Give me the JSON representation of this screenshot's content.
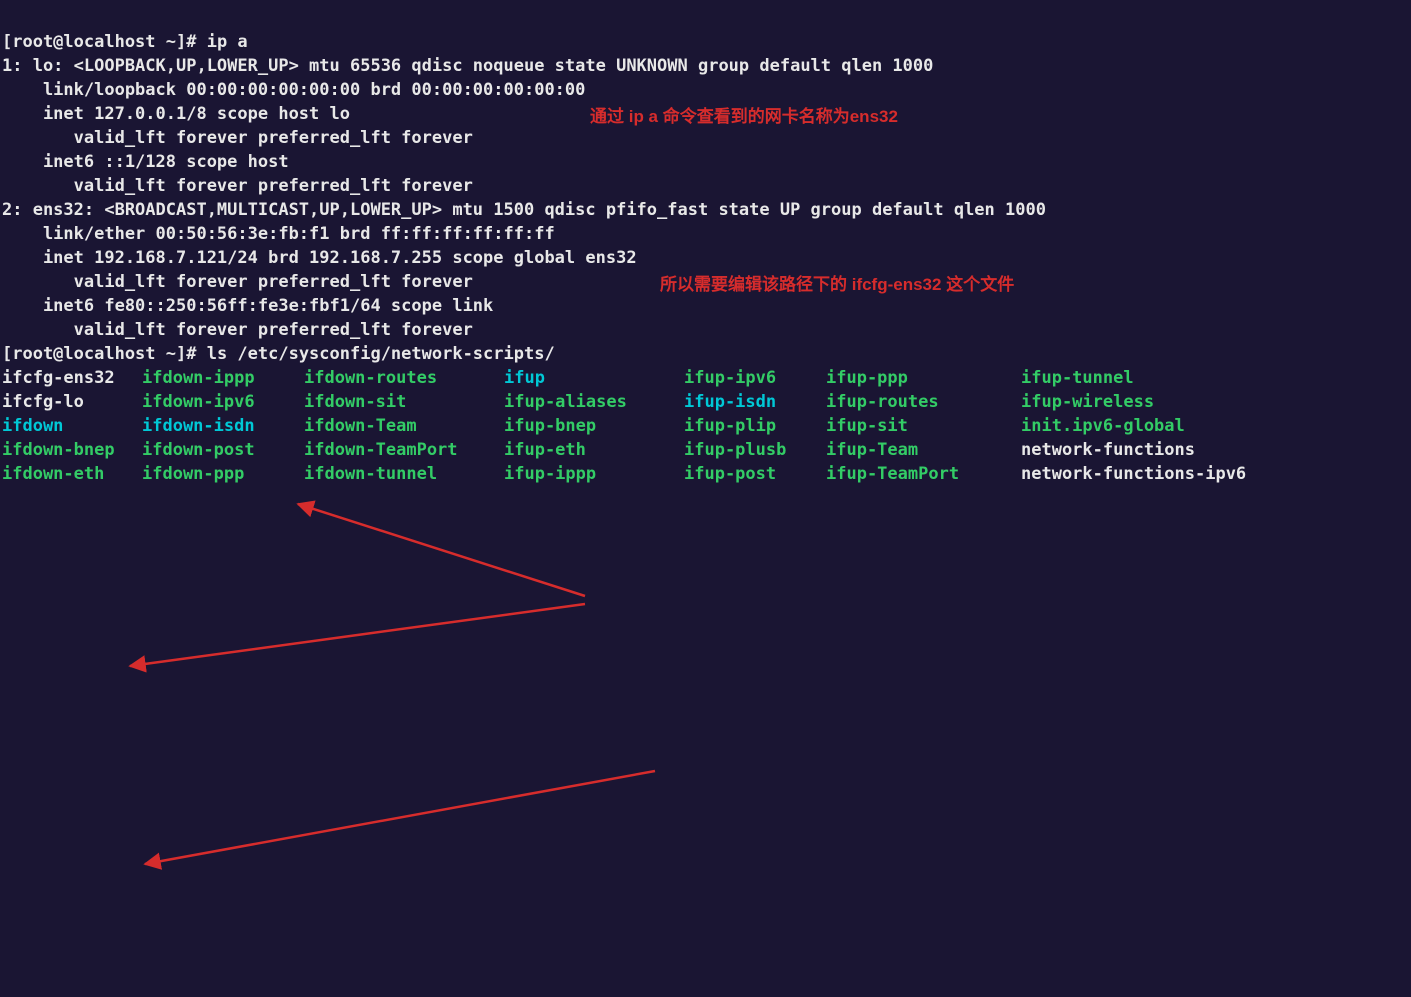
{
  "prompt1_prefix": "[root@localhost ~]# ",
  "cmd1": "ip a",
  "ip_output": [
    "1: lo: <LOOPBACK,UP,LOWER_UP> mtu 65536 qdisc noqueue state UNKNOWN group default qlen 1000",
    "    link/loopback 00:00:00:00:00:00 brd 00:00:00:00:00:00",
    "    inet 127.0.0.1/8 scope host lo",
    "       valid_lft forever preferred_lft forever",
    "    inet6 ::1/128 scope host",
    "       valid_lft forever preferred_lft forever",
    "2: ens32: <BROADCAST,MULTICAST,UP,LOWER_UP> mtu 1500 qdisc pfifo_fast state UP group default qlen 1000",
    "    link/ether 00:50:56:3e:fb:f1 brd ff:ff:ff:ff:ff:ff",
    "    inet 192.168.7.121/24 brd 192.168.7.255 scope global ens32",
    "       valid_lft forever preferred_lft forever",
    "    inet6 fe80::250:56ff:fe3e:fbf1/64 scope link",
    "       valid_lft forever preferred_lft forever"
  ],
  "prompt2_prefix": "[root@localhost ~]# ",
  "cmd2": "ls /etc/sysconfig/network-scripts/",
  "annot1": "通过 ip a 命令查看到的网卡名称为ens32",
  "annot2": "所以需要编辑该路径下的 ifcfg-ens32 这个文件",
  "ls": [
    [
      {
        "t": "ifcfg-ens32",
        "c": "white"
      },
      {
        "t": "ifdown-ippp",
        "c": "green"
      },
      {
        "t": "ifdown-routes",
        "c": "green"
      },
      {
        "t": "ifup",
        "c": "cyan"
      },
      {
        "t": "ifup-ipv6",
        "c": "green"
      },
      {
        "t": "ifup-ppp",
        "c": "green"
      },
      {
        "t": "ifup-tunnel",
        "c": "green"
      }
    ],
    [
      {
        "t": "ifcfg-lo",
        "c": "white"
      },
      {
        "t": "ifdown-ipv6",
        "c": "green"
      },
      {
        "t": "ifdown-sit",
        "c": "green"
      },
      {
        "t": "ifup-aliases",
        "c": "green"
      },
      {
        "t": "ifup-isdn",
        "c": "cyan"
      },
      {
        "t": "ifup-routes",
        "c": "green"
      },
      {
        "t": "ifup-wireless",
        "c": "green"
      }
    ],
    [
      {
        "t": "ifdown",
        "c": "cyan"
      },
      {
        "t": "ifdown-isdn",
        "c": "cyan"
      },
      {
        "t": "ifdown-Team",
        "c": "green"
      },
      {
        "t": "ifup-bnep",
        "c": "green"
      },
      {
        "t": "ifup-plip",
        "c": "green"
      },
      {
        "t": "ifup-sit",
        "c": "green"
      },
      {
        "t": "init.ipv6-global",
        "c": "green"
      }
    ],
    [
      {
        "t": "ifdown-bnep",
        "c": "green"
      },
      {
        "t": "ifdown-post",
        "c": "green"
      },
      {
        "t": "ifdown-TeamPort",
        "c": "green"
      },
      {
        "t": "ifup-eth",
        "c": "green"
      },
      {
        "t": "ifup-plusb",
        "c": "green"
      },
      {
        "t": "ifup-Team",
        "c": "green"
      },
      {
        "t": "network-functions",
        "c": "white"
      }
    ],
    [
      {
        "t": "ifdown-eth",
        "c": "green"
      },
      {
        "t": "ifdown-ppp",
        "c": "green"
      },
      {
        "t": "ifdown-tunnel",
        "c": "green"
      },
      {
        "t": "ifup-ippp",
        "c": "green"
      },
      {
        "t": "ifup-post",
        "c": "green"
      },
      {
        "t": "ifup-TeamPort",
        "c": "green"
      },
      {
        "t": "network-functions-ipv6",
        "c": "white"
      }
    ]
  ]
}
